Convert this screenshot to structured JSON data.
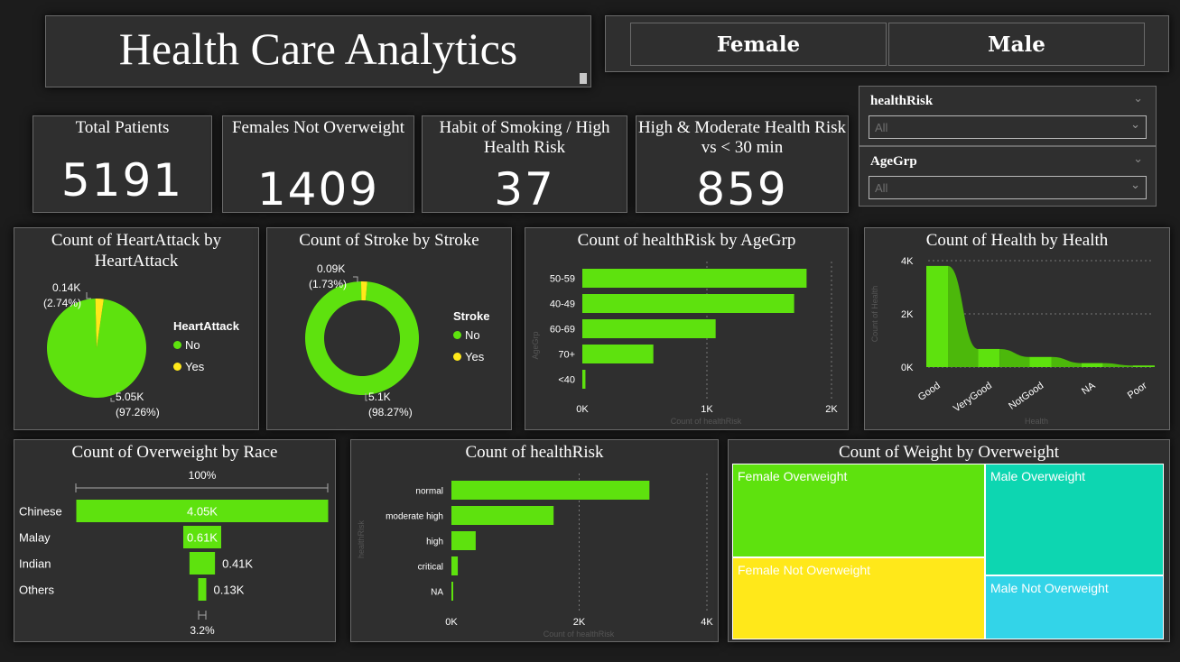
{
  "header": {
    "title": "Health Care Analytics"
  },
  "gender_filter": {
    "female_label": "Female",
    "male_label": "Male"
  },
  "cards": [
    {
      "title": "Total Patients",
      "value": "5191"
    },
    {
      "title": "Females Not Overweight",
      "value": "1409"
    },
    {
      "title": "Habit of Smoking / High Health Risk",
      "value": "37"
    },
    {
      "title": "High & Moderate Health Risk vs < 30 min",
      "value": "859"
    }
  ],
  "slicers": [
    {
      "title": "healthRisk",
      "value": "All"
    },
    {
      "title": "AgeGrp",
      "value": "All"
    }
  ],
  "colors": {
    "green": "#5ee20e",
    "yellow": "#ffe81a",
    "teal": "#0dd6b1",
    "cyan": "#33d4e8",
    "panel": "#2f2f2f"
  },
  "chart_data": [
    {
      "id": "heartattack",
      "type": "pie",
      "title": "Count of HeartAttack by HeartAttack",
      "legend_title": "HeartAttack",
      "slices": [
        {
          "name": "No",
          "value": 5050,
          "label": "5.05K",
          "pct": "(97.26%)",
          "color": "#5ee20e"
        },
        {
          "name": "Yes",
          "value": 140,
          "label": "0.14K",
          "pct": "(2.74%)",
          "color": "#ffe81a"
        }
      ]
    },
    {
      "id": "stroke",
      "type": "pie",
      "title": "Count of Stroke by Stroke",
      "legend_title": "Stroke",
      "slices": [
        {
          "name": "No",
          "value": 5100,
          "label": "5.1K",
          "pct": "(98.27%)",
          "color": "#5ee20e"
        },
        {
          "name": "Yes",
          "value": 90,
          "label": "0.09K",
          "pct": "(1.73%)",
          "color": "#ffe81a"
        }
      ]
    },
    {
      "id": "agegrp",
      "type": "bar",
      "title": "Count of healthRisk by AgeGrp",
      "categories": [
        "50-59",
        "40-49",
        "60-69",
        "70+",
        "<40"
      ],
      "values": [
        1800,
        1700,
        1070,
        570,
        25
      ],
      "xticks": [
        "0K",
        "1K",
        "2K"
      ],
      "xlim": [
        0,
        2000
      ],
      "xlabel": "Count of healthRisk",
      "ylabel": "AgeGrp"
    },
    {
      "id": "health",
      "type": "area",
      "title": "Count of Health by Health",
      "categories": [
        "Good",
        "VeryGood",
        "NotGood",
        "NA",
        "Poor"
      ],
      "values": [
        3800,
        680,
        380,
        150,
        60
      ],
      "yticks": [
        "0K",
        "2K",
        "4K"
      ],
      "ylim": [
        0,
        4000
      ],
      "xlabel": "Health",
      "ylabel": "Count of Health"
    },
    {
      "id": "overweight_race",
      "type": "funnel",
      "title": "Count of Overweight by Race",
      "top_pct": "100%",
      "bottom_pct": "3.2%",
      "categories": [
        "Chinese",
        "Malay",
        "Indian",
        "Others"
      ],
      "values": [
        4050,
        610,
        410,
        130
      ],
      "labels": [
        "4.05K",
        "0.61K",
        "0.41K",
        "0.13K"
      ]
    },
    {
      "id": "healthrisk",
      "type": "bar",
      "title": "Count of healthRisk",
      "categories": [
        "normal",
        "moderate high",
        "high",
        "critical",
        "NA"
      ],
      "values": [
        3100,
        1600,
        380,
        100,
        20
      ],
      "xticks": [
        "0K",
        "2K",
        "4K"
      ],
      "xlim": [
        0,
        4000
      ],
      "xlabel": "Count of healthRisk",
      "ylabel": "healthRisk"
    },
    {
      "id": "weight_overweight",
      "type": "treemap",
      "title": "Count of Weight by Overweight",
      "cells": [
        {
          "name": "Female Overweight",
          "color": "#5ee20e"
        },
        {
          "name": "Female Not Overweight",
          "color": "#ffe81a"
        },
        {
          "name": "Male Overweight",
          "color": "#0dd6b1"
        },
        {
          "name": "Male Not Overweight",
          "color": "#33d4e8"
        }
      ]
    }
  ]
}
